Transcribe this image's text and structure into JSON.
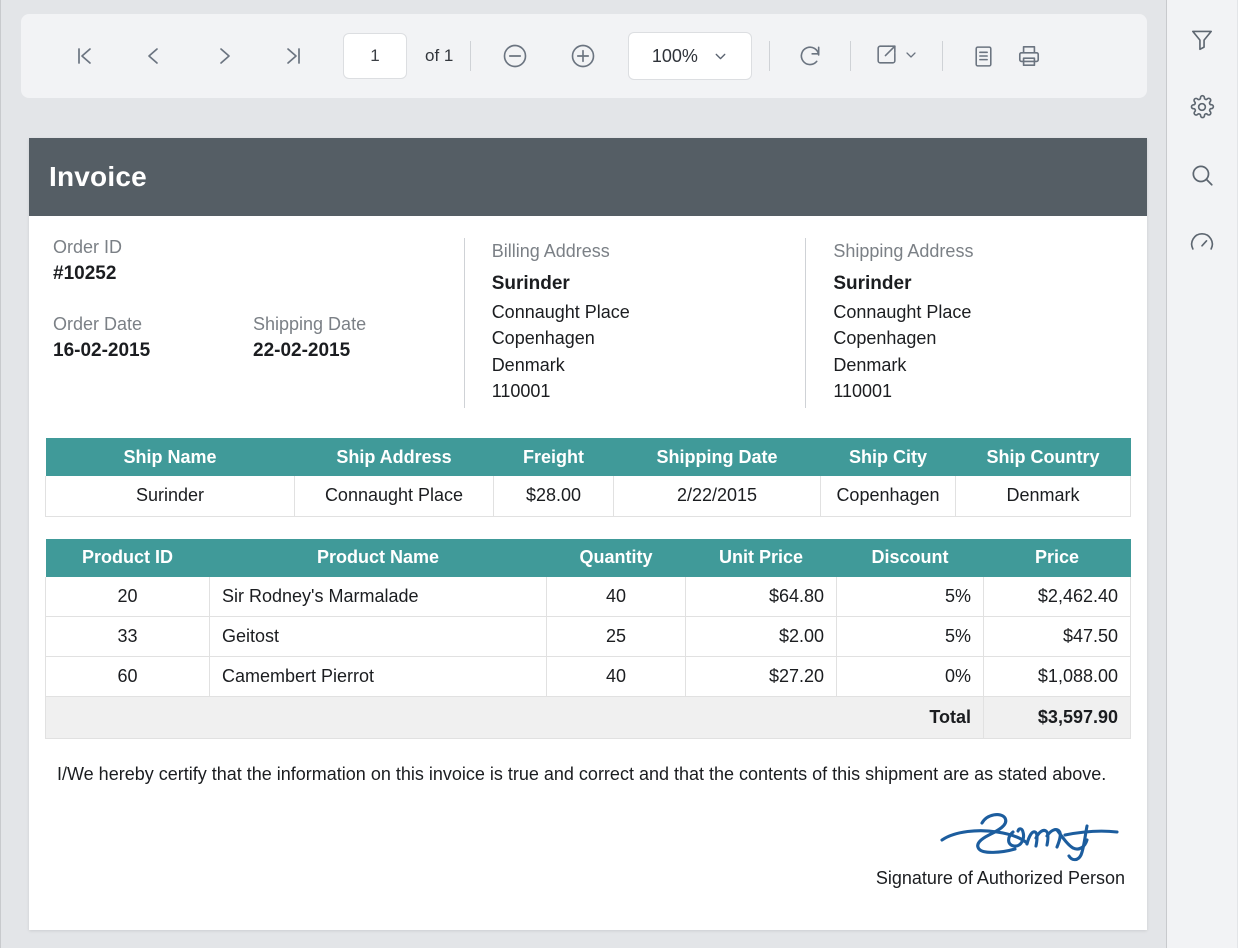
{
  "toolbar": {
    "first_page_icon": "first-page-icon",
    "prev_page_icon": "previous-page-icon",
    "next_page_icon": "next-page-icon",
    "last_page_icon": "last-page-icon",
    "page_number": "1",
    "page_count_label": "of 1",
    "zoom_out_icon": "zoom-out-icon",
    "zoom_in_icon": "zoom-in-icon",
    "zoom_value": "100%",
    "refresh_icon": "refresh-icon",
    "export_icon": "export-icon",
    "export_chevron_icon": "chevron-down-icon",
    "page_setup_icon": "document-icon",
    "print_icon": "print-icon"
  },
  "rail": {
    "items": [
      {
        "name": "filter-icon",
        "label": "Filter"
      },
      {
        "name": "gear-icon",
        "label": "Settings"
      },
      {
        "name": "search-icon",
        "label": "Search"
      },
      {
        "name": "gauge-icon",
        "label": "Performance"
      }
    ]
  },
  "invoice": {
    "title": "Invoice",
    "order_id_label": "Order ID",
    "order_id_value": "#10252",
    "order_date_label": "Order Date",
    "order_date_value": "16-02-2015",
    "shipping_date_label": "Shipping Date",
    "shipping_date_value": "22-02-2015",
    "billing": {
      "label": "Billing Address",
      "name": "Surinder",
      "street": "Connaught Place",
      "city": "Copenhagen",
      "country": "Denmark",
      "postal": "110001"
    },
    "shipping": {
      "label": "Shipping Address",
      "name": "Surinder",
      "street": "Connaught Place",
      "city": "Copenhagen",
      "country": "Denmark",
      "postal": "110001"
    },
    "ship_table": {
      "headers": [
        "Ship Name",
        "Ship Address",
        "Freight",
        "Shipping Date",
        "Ship City",
        "Ship Country"
      ],
      "row": [
        "Surinder",
        "Connaught Place",
        "$28.00",
        "2/22/2015",
        "Copenhagen",
        "Denmark"
      ]
    },
    "product_table": {
      "headers": [
        "Product ID",
        "Product Name",
        "Quantity",
        "Unit Price",
        "Discount",
        "Price"
      ],
      "rows": [
        {
          "id": "20",
          "name": "Sir Rodney's Marmalade",
          "qty": "40",
          "unit_price": "$64.80",
          "discount": "5%",
          "price": "$2,462.40"
        },
        {
          "id": "33",
          "name": "Geitost",
          "qty": "25",
          "unit_price": "$2.00",
          "discount": "5%",
          "price": "$47.50"
        },
        {
          "id": "60",
          "name": "Camembert Pierrot",
          "qty": "40",
          "unit_price": "$27.20",
          "discount": "0%",
          "price": "$1,088.00"
        }
      ],
      "total_label": "Total",
      "total_value": "$3,597.90"
    },
    "certification": "I/We hereby certify that the information on this invoice is true and correct and that the contents of this shipment are as stated above.",
    "signature_caption": "Signature of Authorized Person"
  },
  "colors": {
    "header_dark": "#555e65",
    "table_header_teal": "#409a99",
    "signature_blue": "#1c5d9e",
    "app_background": "#e3e5e8",
    "toolbar_background": "#f2f3f5",
    "total_row_background": "#f0f0f0"
  }
}
